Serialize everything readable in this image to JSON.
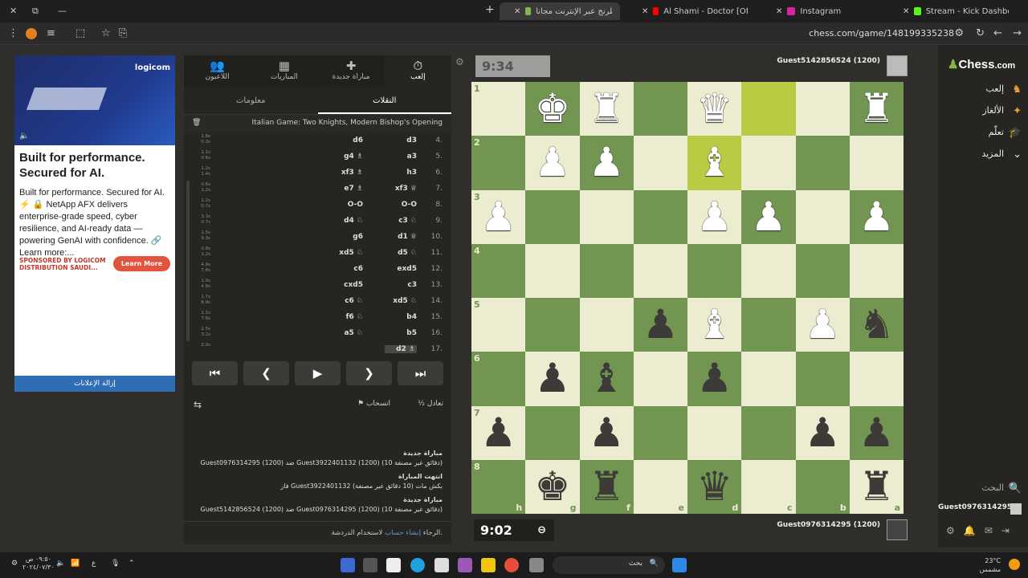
{
  "browser": {
    "tabs": [
      {
        "title": "Stream - Kick Dashboard",
        "color": "#53fc18"
      },
      {
        "title": "Instagram",
        "color": "#d6249f"
      },
      {
        "title": "Al Shami - Doctor [Official Mus",
        "color": "#ff0000"
      },
      {
        "title": "إلعب الشطرنج عبر الإنترنت مجاناً",
        "color": "#81b64c"
      }
    ],
    "new_tab": "+",
    "url": "chess.com/game/148199335238"
  },
  "ad": {
    "logo": "logicom",
    "headline": "Built for performance. Secured for AI.",
    "body": "Built for performance. Secured for AI. ⚡ 🔒 NetApp AFX delivers enterprise-grade speed, cyber resilience, and AI-ready data — powering GenAI with confidence. 🔗 Learn more:...",
    "sponsor": "SPONSORED BY LOGICOM DISTRIBUTION SAUDI...",
    "cta": "Learn More",
    "remove": "إزالة الإعلانات"
  },
  "panel": {
    "tabs": [
      {
        "label": "إلعب",
        "icon": "⏱"
      },
      {
        "label": "مباراة جديدة",
        "icon": "✚"
      },
      {
        "label": "المباريات",
        "icon": "▦"
      },
      {
        "label": "اللاعبون",
        "icon": "👥"
      }
    ],
    "subtabs": {
      "moves": "النقلات",
      "info": "معلومات"
    },
    "opening": "Italian Game: Two Knights, Modern Bishop's Opening",
    "moves": [
      {
        "n": "4.",
        "w": "d3",
        "b": "d6",
        "t1": "1.8s",
        "t2": "0.3s"
      },
      {
        "n": "5.",
        "w": "a3",
        "b": "g4 ♗",
        "t1": "1.1s",
        "t2": "0.6s"
      },
      {
        "n": "6.",
        "w": "h3",
        "b": "xf3 ♗",
        "t1": "1.2s",
        "t2": "1.4s"
      },
      {
        "n": "7.",
        "w": "xf3 ♕",
        "b": "e7 ♗",
        "t1": "0.6s",
        "t2": "1.2s"
      },
      {
        "n": "8.",
        "w": "O-O",
        "b": "O-O",
        "t1": "1.2s",
        "t2": "0.7s"
      },
      {
        "n": "9.",
        "w": "c3 ♘",
        "b": "d4 ♘",
        "t1": "3.3s",
        "t2": "0.7s"
      },
      {
        "n": "10.",
        "w": "d1 ♕",
        "b": "g6",
        "t1": "1.5s",
        "t2": "9.3s"
      },
      {
        "n": "11.",
        "w": "d5 ♘",
        "b": "xd5 ♘",
        "t1": "0.8s",
        "t2": "1.2s"
      },
      {
        "n": "12.",
        "w": "exd5",
        "b": "c6",
        "t1": "4.9s",
        "t2": "7.8s"
      },
      {
        "n": "13.",
        "w": "c3",
        "b": "cxd5",
        "t1": "1.0s",
        "t2": "4.9s"
      },
      {
        "n": "14.",
        "w": "xd5 ♘",
        "b": "c6 ♘",
        "t1": "1.7s",
        "t2": "8.9s"
      },
      {
        "n": "15.",
        "w": "b4",
        "b": "f6 ♘",
        "t1": "1.1s",
        "t2": "7.8s"
      },
      {
        "n": "16.",
        "w": "b5",
        "b": "a5 ♘",
        "t1": "2.5s",
        "t2": "3.2s"
      },
      {
        "n": "17.",
        "w": "d2 ♗",
        "b": "",
        "t1": "2.0s",
        "t2": ""
      }
    ],
    "nav": [
      "⏮",
      "❮",
      "▶",
      "❯",
      "⏭"
    ],
    "draw": "½ تعادل",
    "resign": "⚑ انسحاب",
    "log": [
      {
        "title": "مباراة جديدة",
        "text": "Guest0976314295 (1200) ضد Guest3922401132 (1200) (10 دقائق غير مصنفة)"
      },
      {
        "title": "انتهت المباراة",
        "text": "فاز Guest3922401132 بكش مات (10 دقائق غير مصنفة)"
      },
      {
        "title": "مباراة جديدة",
        "text": "Guest5142856524 (1200) ضد Guest0976314295 (1200) (10 دقائق غير مصنفة)"
      }
    ],
    "chat_prefix": "الرجاء ",
    "chat_link": "إنشاء حساب",
    "chat_suffix": " لاستخدام الدردشة."
  },
  "game": {
    "top_clock": "9:34",
    "bottom_clock": "9:02",
    "top_player": "Guest5142856524 (1200)",
    "bottom_player": "Guest0976314295 (1200)",
    "rows": [
      [
        "",
        "wK",
        "wR",
        "",
        "wQ",
        "",
        "",
        "wR"
      ],
      [
        "",
        "wP",
        "wP",
        "",
        "wB",
        "",
        "",
        ""
      ],
      [
        "wP",
        "",
        "",
        "",
        "wP",
        "wP",
        "",
        "wP"
      ],
      [
        "",
        "",
        "",
        "",
        "",
        "",
        "",
        ""
      ],
      [
        "",
        "",
        "",
        "bP",
        "wB",
        "",
        "wP",
        "bN"
      ],
      [
        "",
        "bP",
        "bB",
        "",
        "bP",
        "",
        "",
        ""
      ],
      [
        "bP",
        "",
        "bP",
        "",
        "",
        "",
        "bP",
        "bP"
      ],
      [
        "",
        "bK",
        "bR",
        "",
        "bQ",
        "",
        "",
        "bR"
      ]
    ],
    "ranks": [
      "1",
      "2",
      "3",
      "4",
      "5",
      "6",
      "7",
      "8"
    ],
    "files": [
      "h",
      "g",
      "f",
      "e",
      "d",
      "c",
      "b",
      "a"
    ],
    "highlights": [
      [
        0,
        5
      ],
      [
        1,
        4
      ]
    ]
  },
  "sidebar": {
    "brand": "Chess",
    "brand_suffix": ".com",
    "items": [
      {
        "label": "إلعب",
        "icon": "♞"
      },
      {
        "label": "الألغاز",
        "icon": "✦"
      },
      {
        "label": "تعلّم",
        "icon": "🎓"
      },
      {
        "label": "المزيد",
        "icon": "⌄"
      }
    ],
    "search": "البحث",
    "user": "Guest0976314295"
  },
  "taskbar": {
    "time": "٠٩:٥٠ ص",
    "date": "٢٠٢٤/٠٧/٣٠",
    "lang": "ع",
    "search": "بحث",
    "weather": "23°C",
    "weather_desc": "مشمس"
  }
}
